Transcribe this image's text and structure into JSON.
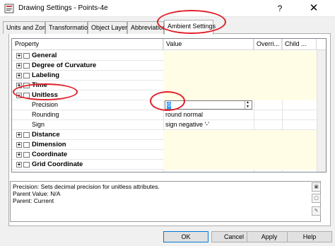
{
  "window": {
    "title": "Drawing Settings - Points-4e",
    "help_glyph": "?",
    "close_glyph": "✕"
  },
  "tabs": [
    {
      "label": "Units and Zone"
    },
    {
      "label": "Transformation"
    },
    {
      "label": "Object Layers"
    },
    {
      "label": "Abbreviations"
    },
    {
      "label": "Ambient Settings"
    }
  ],
  "grid": {
    "columns": [
      "Property",
      "Value",
      "Overri...",
      "Child ..."
    ],
    "rows": [
      {
        "type": "category",
        "label": "General",
        "expander": "+"
      },
      {
        "type": "category",
        "label": "Degree of Curvature",
        "expander": "+"
      },
      {
        "type": "category",
        "label": "Labeling",
        "expander": "+"
      },
      {
        "type": "category",
        "label": "Time",
        "expander": "+"
      },
      {
        "type": "category",
        "label": "Unitless",
        "expander": "−"
      },
      {
        "type": "property",
        "label": "Precision",
        "value": "0"
      },
      {
        "type": "property",
        "label": "Rounding",
        "value": "round normal"
      },
      {
        "type": "property",
        "label": "Sign",
        "value": "sign negative '-'"
      },
      {
        "type": "category",
        "label": "Distance",
        "expander": "+"
      },
      {
        "type": "category",
        "label": "Dimension",
        "expander": "+"
      },
      {
        "type": "category",
        "label": "Coordinate",
        "expander": "+"
      },
      {
        "type": "category",
        "label": "Grid Coordinate",
        "expander": "+"
      }
    ]
  },
  "description": {
    "line1": "Precision: Sets decimal precision for unitless attributes.",
    "line2": "Parent Value: N/A",
    "line3": "Parent: Current"
  },
  "buttons": {
    "ok": "OK",
    "cancel": "Cancel",
    "apply": "Apply",
    "help": "Help"
  },
  "colors": {
    "annotation": "#e0202a",
    "category_fill": "#fffde6",
    "selection": "#3399ff"
  },
  "icons": {
    "app": "drawing-settings-icon",
    "folder": "folder-icon",
    "help": "question-icon",
    "close": "close-icon"
  }
}
